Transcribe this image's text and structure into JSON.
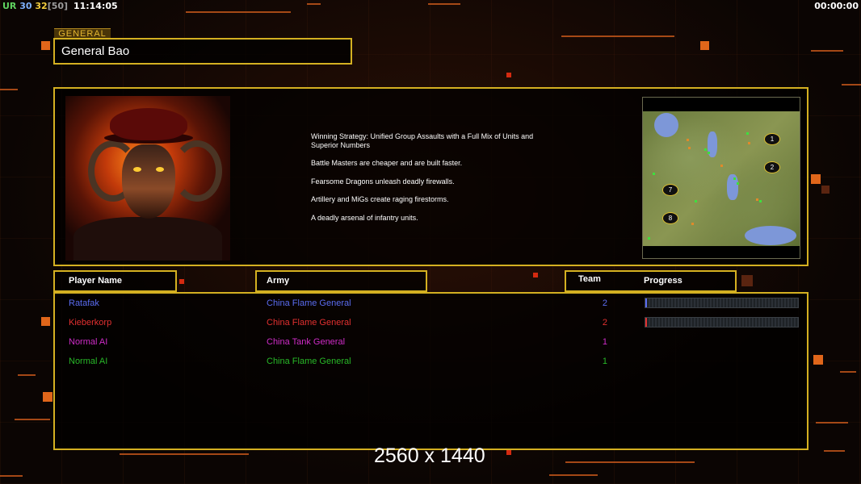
{
  "hud": {
    "ur_label": "UR",
    "val1": "30",
    "val2": "32",
    "val3": "[50]",
    "clock": "11:14:05",
    "timer": "00:00:00"
  },
  "general": {
    "tag": "GENERAL",
    "name": "General Bao"
  },
  "description": {
    "line1": "Winning Strategy: Unified Group Assaults with a Full Mix of Units and",
    "line1b": " Superior Numbers",
    "line2": "Battle Masters are cheaper and are built faster.",
    "line3": "Fearsome Dragons unleash deadly firewalls.",
    "line4": "Artillery and MiGs create raging firestorms.",
    "line5": "A deadly arsenal of infantry units."
  },
  "minimap": {
    "spots": [
      "1",
      "2",
      "7",
      "8"
    ]
  },
  "columns": {
    "player": "Player Name",
    "army": "Army",
    "team": "Team",
    "progress": "Progress"
  },
  "players": [
    {
      "name": "Ratafak",
      "army": "China Flame General",
      "team": "2",
      "color": "#5a6cf0",
      "progress": 0.01
    },
    {
      "name": "Kieberkorp",
      "army": "China Flame General",
      "team": "2",
      "color": "#e23030",
      "progress": 0.01
    },
    {
      "name": "Normal AI",
      "army": "China Tank General",
      "team": "1",
      "color": "#d02cc8"
    },
    {
      "name": "Normal AI",
      "army": "China Flame General",
      "team": "1",
      "color": "#28b828"
    }
  ],
  "resolution": "2560 x 1440"
}
